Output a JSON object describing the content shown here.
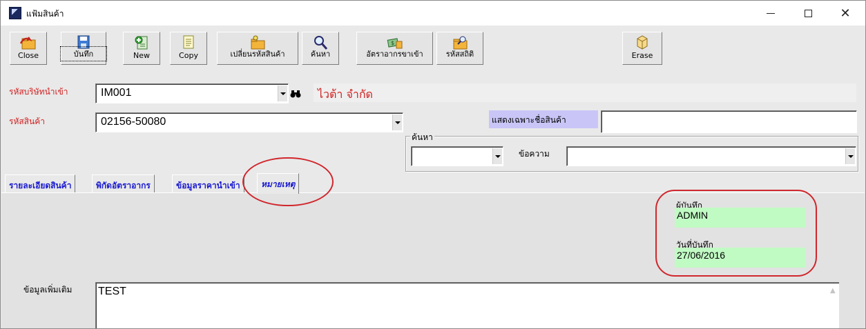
{
  "window": {
    "title": "แฟ้มสินค้า",
    "controls": {
      "minimize": "—",
      "maximize": "☐",
      "close": "✕"
    }
  },
  "toolbar": {
    "buttons": [
      {
        "label": "Close",
        "icon": "folder-arrow-icon"
      },
      {
        "label": "บันทึก",
        "icon": "floppy-disk-icon"
      },
      {
        "label": "New",
        "icon": "new-document-icon"
      },
      {
        "label": "Copy",
        "icon": "copy-document-icon"
      },
      {
        "label": "เปลี่ยนรหัสสินค้า",
        "icon": "change-code-folder-icon"
      },
      {
        "label": "ค้นหา",
        "icon": "magnifier-icon"
      },
      {
        "label": "อัตราอากรขาเข้า",
        "icon": "money-tax-icon"
      },
      {
        "label": "รหัสสถิติ",
        "icon": "statistics-folder-icon"
      },
      {
        "label": "Erase",
        "icon": "eraser-icon"
      }
    ]
  },
  "form": {
    "importer_code_label": "รหัสบริษัทนำเข้า",
    "importer_code_value": "IM001",
    "company_name": "ไวต้า จำกัด",
    "product_code_label": "รหัสสินค้า",
    "product_code_value": "02156-50080",
    "show_only_name_label": "แสดงเฉพาะชื่อสินค้า",
    "show_only_name_value": "",
    "search_group_label": "ค้นหา",
    "search_field_value": "",
    "message_label": "ข้อความ",
    "message_value": ""
  },
  "tabs": [
    {
      "label": "รายละเอียดสินค้า",
      "active": false
    },
    {
      "label": "พิกัดอัตราอากร",
      "active": false
    },
    {
      "label": "ข้อมูลราคานำเข้า",
      "active": false
    },
    {
      "label": "หมายเหตุ",
      "active": true
    }
  ],
  "remarks": {
    "recorded_by_label": "ผู้บันทึก",
    "recorded_by_value": "ADMIN",
    "recorded_date_label": "วันที่บันทึก",
    "recorded_date_value": "27/06/2016",
    "additional_info_label": "ข้อมูลเพิ่มเติม",
    "additional_info_value": "TEST"
  },
  "colors": {
    "highlight_green": "#c0fbc3",
    "label_red": "#d01f1f",
    "tab_blue": "#1a1ad0",
    "annotation_red": "#d0262c",
    "filter_label_bg": "#c9c6f7"
  }
}
